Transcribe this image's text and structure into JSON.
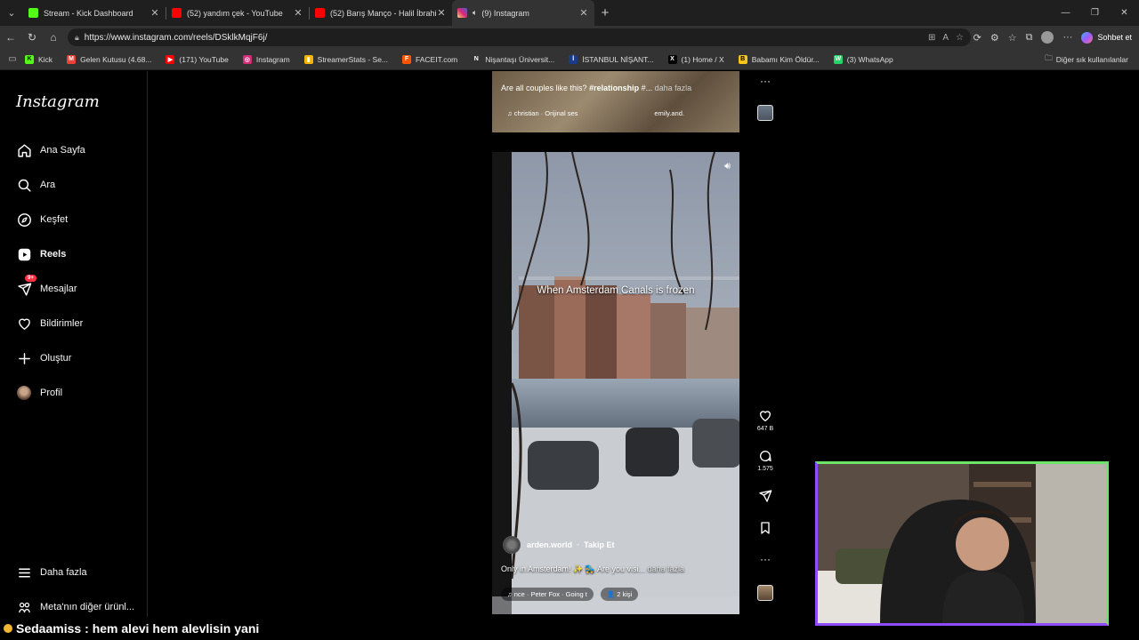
{
  "browser": {
    "tabs": [
      {
        "title": "Stream - Kick Dashboard",
        "color": "#53fc18",
        "active": false
      },
      {
        "title": "(52) yandım çek - YouTube",
        "color": "#ff0000",
        "active": false
      },
      {
        "title": "(52) Barış Manço - Halil İbrahim Sofrası",
        "color": "#ff0000",
        "active": false
      },
      {
        "title": "(9) Instagram",
        "color": "#d62976",
        "active": true
      }
    ],
    "url": "https://www.instagram.com/reels/DSklkMqjF6j/",
    "copilot_label": "Sohbet et",
    "bookmarks": [
      {
        "label": "Kick",
        "color": "#53fc18",
        "icon": "K"
      },
      {
        "label": "Gelen Kutusu (4.68...",
        "color": "#ea4335",
        "icon": "M"
      },
      {
        "label": "(171) YouTube",
        "color": "#ff0000",
        "icon": "▶"
      },
      {
        "label": "Instagram",
        "color": "#d62976",
        "icon": "◎"
      },
      {
        "label": "StreamerStats - Se...",
        "color": "#f4b400",
        "icon": "▮"
      },
      {
        "label": "FACEIT.com",
        "color": "#ff5500",
        "icon": "F"
      },
      {
        "label": "Nişantaşı Üniversit...",
        "color": "#333333",
        "icon": "N"
      },
      {
        "label": "İSTANBUL NİŞANT...",
        "color": "#1a3a8a",
        "icon": "İ"
      },
      {
        "label": "(1) Home / X",
        "color": "#000000",
        "icon": "X"
      },
      {
        "label": "Babamı Kim Öldür...",
        "color": "#f5c518",
        "icon": "B"
      },
      {
        "label": "(3) WhatsApp",
        "color": "#25d366",
        "icon": "W"
      }
    ],
    "other_bookmarks": "Diğer sık kullanılanlar"
  },
  "sidebar": {
    "logo": "Instagram",
    "items": [
      {
        "label": "Ana Sayfa",
        "icon": "home-icon"
      },
      {
        "label": "Ara",
        "icon": "search-icon"
      },
      {
        "label": "Keşfet",
        "icon": "compass-icon"
      },
      {
        "label": "Reels",
        "icon": "reels-icon"
      },
      {
        "label": "Mesajlar",
        "icon": "messenger-icon",
        "badge": "9+"
      },
      {
        "label": "Bildirimler",
        "icon": "heart-icon"
      },
      {
        "label": "Oluştur",
        "icon": "plus-icon"
      },
      {
        "label": "Profil",
        "icon": "avatar"
      }
    ],
    "more": "Daha fazla",
    "meta": "Meta'nın diğer ürünl..."
  },
  "prev_reel": {
    "caption_text": "Are all couples like this? ",
    "caption_tag": "#relationship",
    "caption_rest": " #...",
    "more": "daha fazla",
    "music": "♫ christian · Orijinal ses",
    "account": "emily.and."
  },
  "reel": {
    "overlay_text": "When Amsterdam Canals is frozen",
    "username": "arden.world",
    "follow": "Takip Et",
    "caption": "Only in Amsterdam! ✨ 🛼 Are you visi...",
    "more": "daha fazla",
    "music": "♫ nce · Peter Fox · Going t",
    "people": "👤 2 kişi"
  },
  "actions": {
    "likes": "647 B",
    "comments": "1.575"
  },
  "stream_chat": {
    "user": "Sedaamiss",
    "message": ": hem alevi hem alevlisin yani"
  }
}
